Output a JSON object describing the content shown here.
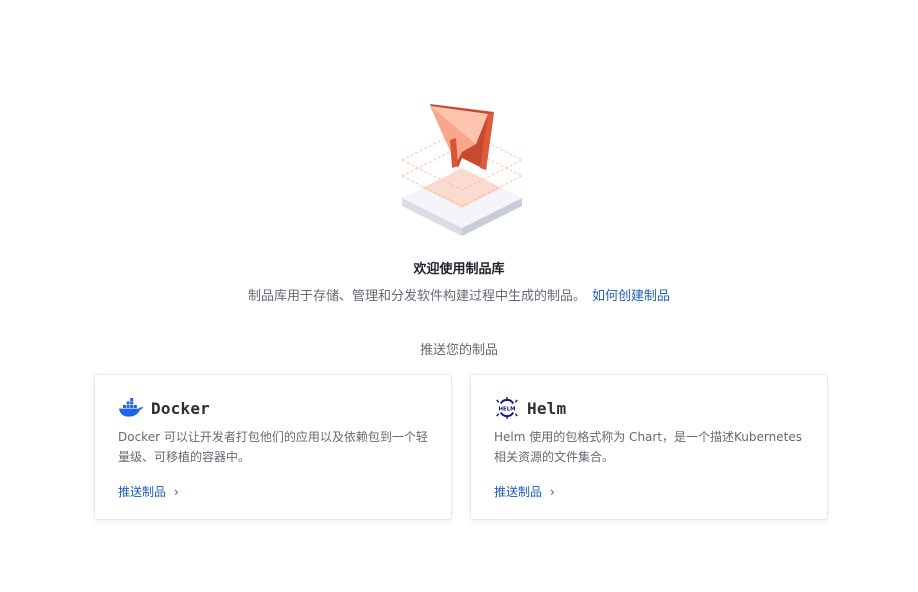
{
  "welcome": {
    "title": "欢迎使用制品库",
    "description": "制品库用于存储、管理和分发软件构建过程中生成的制品。",
    "how_to_link": "如何创建制品"
  },
  "push_section": {
    "title": "推送您的制品"
  },
  "cards": [
    {
      "name": "Docker",
      "icon": "docker-icon",
      "description": "Docker 可以让开发者打包他们的应用以及依赖包到一个轻量级、可移植的容器中。",
      "action": "推送制品"
    },
    {
      "name": "Helm",
      "icon": "helm-icon",
      "description": "Helm 使用的包格式称为 Chart，是一个描述Kubernetes相关资源的文件集合。",
      "action": "推送制品"
    }
  ],
  "colors": {
    "link": "#1f5fbf",
    "illustration_accent": "#f06a4b",
    "docker_blue": "#1d63ed",
    "helm_navy": "#0f1689"
  }
}
